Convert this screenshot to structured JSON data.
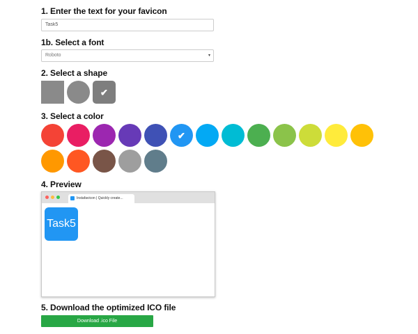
{
  "step1": {
    "title": "1. Enter the text for your favicon",
    "value": "Task5"
  },
  "step1b": {
    "title": "1b. Select a font",
    "selected": "Roboto",
    "caret": "▾"
  },
  "step2": {
    "title": "2. Select a shape",
    "shapes": [
      {
        "name": "square",
        "selected": false
      },
      {
        "name": "circle",
        "selected": false
      },
      {
        "name": "rounded",
        "selected": true
      }
    ],
    "check_glyph": "✔"
  },
  "step3": {
    "title": "3. Select a color",
    "colors": [
      "#f44336",
      "#e91e63",
      "#9c27b0",
      "#673ab7",
      "#3f51b5",
      "#2196f3",
      "#03a9f4",
      "#00bcd4",
      "#4caf50",
      "#8bc34a",
      "#cddc39",
      "#ffeb3b",
      "#ffc107",
      "#ff9800",
      "#ff5722",
      "#795548",
      "#9e9e9e",
      "#607d8b"
    ],
    "selected_color": "#2196f3"
  },
  "step4": {
    "title": "4. Preview",
    "tab_title": "Instafavicon | Quickly create...",
    "icon_text": "Task5",
    "icon_color": "#2196f3"
  },
  "step5": {
    "title": "5. Download the optimized ICO file",
    "button_label": "Download .ico File"
  }
}
